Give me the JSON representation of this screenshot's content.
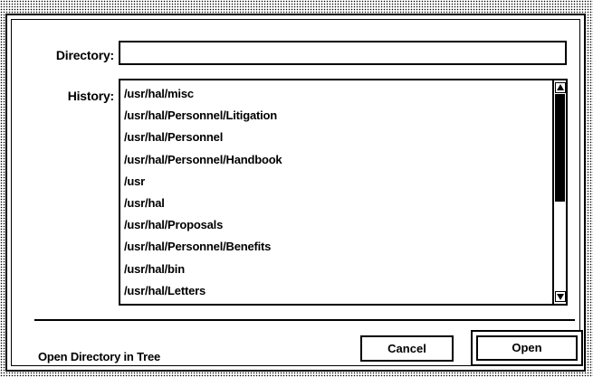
{
  "dialog": {
    "directory_label": "Directory:",
    "directory_value": "",
    "history_label": "History:",
    "history_items": [
      "/usr/hal/misc",
      "/usr/hal/Personnel/Litigation",
      "/usr/hal/Personnel",
      "/usr/hal/Personnel/Handbook",
      "/usr",
      "/usr/hal",
      "/usr/hal/Proposals",
      "/usr/hal/Personnel/Benefits",
      "/usr/hal/bin",
      "/usr/hal/Letters"
    ],
    "scroll_position": 0.0,
    "scroll_visible_fraction": 0.55,
    "status_text": "Open Directory in Tree",
    "cancel_label": "Cancel",
    "open_label": "Open"
  },
  "icons": {
    "scroll_up": "up-arrow-icon",
    "scroll_down": "down-arrow-icon"
  }
}
